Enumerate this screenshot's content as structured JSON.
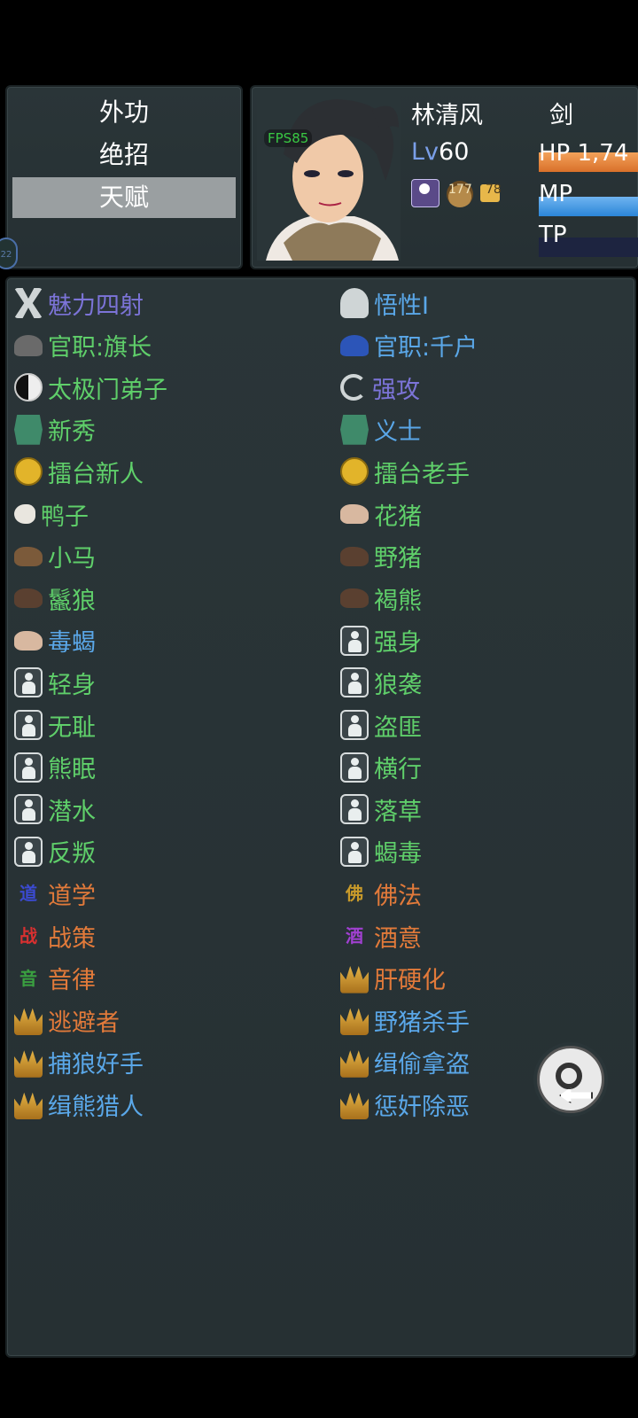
{
  "menu": {
    "items": [
      {
        "label": "外功"
      },
      {
        "label": "绝招"
      },
      {
        "label": "天赋"
      }
    ],
    "selected_index": 2
  },
  "character": {
    "name": "林清风",
    "weapon": "剑",
    "level_prefix": "Lv",
    "level_value": "60",
    "fps": "FPS85",
    "food_value": "177",
    "card_value": "78",
    "hp_label": "HP",
    "hp_value": "1,74",
    "mp_label": "MP",
    "tp_label": "TP"
  },
  "talents": [
    {
      "label": "魅力四射",
      "color": "#7c74d8",
      "icon": "x-cross-icon"
    },
    {
      "label": "悟性I",
      "color": "#5aa7e8",
      "icon": "meditate-icon"
    },
    {
      "label": "官职:旗长",
      "color": "#5fcf6a",
      "icon": "official-hat-icon"
    },
    {
      "label": "官职:千户",
      "color": "#5aa7e8",
      "icon": "official-hat-blue-icon"
    },
    {
      "label": "太极门弟子",
      "color": "#5fcf6a",
      "icon": "yin-yang-icon"
    },
    {
      "label": "强攻",
      "color": "#7c74d8",
      "icon": "swirl-icon"
    },
    {
      "label": "新秀",
      "color": "#5fcf6a",
      "icon": "badge-icon"
    },
    {
      "label": "义士",
      "color": "#5aa7e8",
      "icon": "badge-icon"
    },
    {
      "label": "擂台新人",
      "color": "#5fcf6a",
      "icon": "fist-icon"
    },
    {
      "label": "擂台老手",
      "color": "#5fcf6a",
      "icon": "fist-icon"
    },
    {
      "label": "鸭子",
      "color": "#5fcf6a",
      "icon": "duck-icon"
    },
    {
      "label": "花猪",
      "color": "#5fcf6a",
      "icon": "pig-icon"
    },
    {
      "label": "小马",
      "color": "#5fcf6a",
      "icon": "horse-icon"
    },
    {
      "label": "野猪",
      "color": "#5fcf6a",
      "icon": "boar-icon"
    },
    {
      "label": "鬣狼",
      "color": "#5fcf6a",
      "icon": "hyena-icon"
    },
    {
      "label": "褐熊",
      "color": "#5fcf6a",
      "icon": "bear-icon"
    },
    {
      "label": "毒蝎",
      "color": "#5aa7e8",
      "icon": "scorpion-icon"
    },
    {
      "label": "强身",
      "color": "#5fcf6a",
      "icon": "silhouette-icon"
    },
    {
      "label": "轻身",
      "color": "#5fcf6a",
      "icon": "silhouette-icon"
    },
    {
      "label": "狼袭",
      "color": "#5fcf6a",
      "icon": "silhouette-icon"
    },
    {
      "label": "无耻",
      "color": "#5fcf6a",
      "icon": "silhouette-icon"
    },
    {
      "label": "盗匪",
      "color": "#5fcf6a",
      "icon": "silhouette-icon"
    },
    {
      "label": "熊眠",
      "color": "#5fcf6a",
      "icon": "silhouette-icon"
    },
    {
      "label": "横行",
      "color": "#5fcf6a",
      "icon": "silhouette-icon"
    },
    {
      "label": "潜水",
      "color": "#5fcf6a",
      "icon": "silhouette-icon"
    },
    {
      "label": "落草",
      "color": "#5fcf6a",
      "icon": "silhouette-icon"
    },
    {
      "label": "反叛",
      "color": "#5fcf6a",
      "icon": "silhouette-icon"
    },
    {
      "label": "蝎毒",
      "color": "#5fcf6a",
      "icon": "silhouette-icon"
    },
    {
      "label": "道学",
      "color": "#e27a3a",
      "icon": "dao-glyph-icon",
      "glyph": "道",
      "glyph_color": "#3b4ad0"
    },
    {
      "label": "佛法",
      "color": "#e27a3a",
      "icon": "fo-glyph-icon",
      "glyph": "佛",
      "glyph_color": "#c89a2a"
    },
    {
      "label": "战策",
      "color": "#e27a3a",
      "icon": "zhan-glyph-icon",
      "glyph": "战",
      "glyph_color": "#d83030"
    },
    {
      "label": "酒意",
      "color": "#e27a3a",
      "icon": "jiu-glyph-icon",
      "glyph": "酒",
      "glyph_color": "#a040d0"
    },
    {
      "label": "音律",
      "color": "#e27a3a",
      "icon": "yin-glyph-icon",
      "glyph": "音",
      "glyph_color": "#3aa040"
    },
    {
      "label": "肝硬化",
      "color": "#e27a3a",
      "icon": "crown-icon"
    },
    {
      "label": "逃避者",
      "color": "#e27a3a",
      "icon": "crown-icon"
    },
    {
      "label": "野猪杀手",
      "color": "#5aa7e8",
      "icon": "crown-icon"
    },
    {
      "label": "捕狼好手",
      "color": "#5aa7e8",
      "icon": "crown-icon"
    },
    {
      "label": "缉偷拿盗",
      "color": "#5aa7e8",
      "icon": "crown-icon"
    },
    {
      "label": "缉熊猎人",
      "color": "#5aa7e8",
      "icon": "crown-icon"
    },
    {
      "label": "惩奸除恶",
      "color": "#5aa7e8",
      "icon": "crown-icon"
    }
  ]
}
